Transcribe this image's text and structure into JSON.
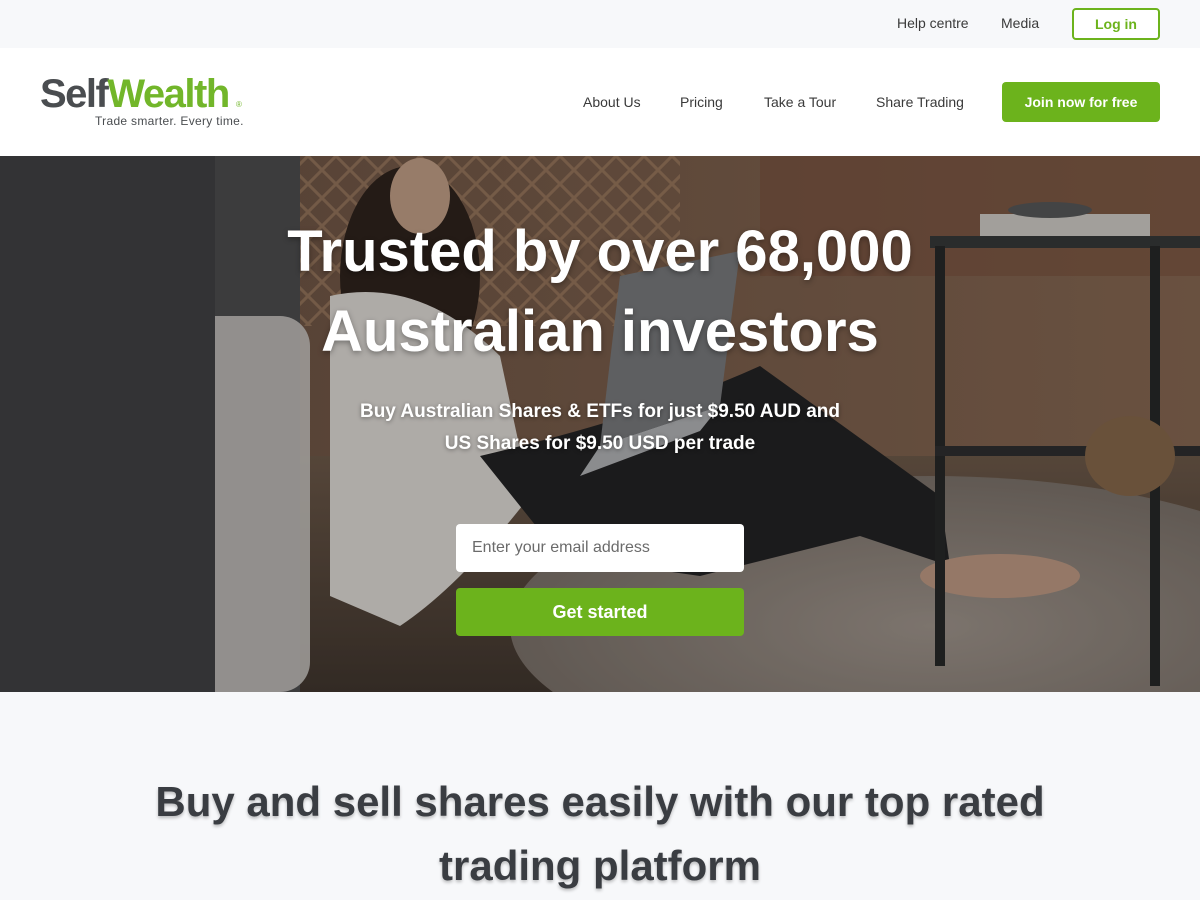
{
  "utility_nav": {
    "help_label": "Help centre",
    "media_label": "Media",
    "login_label": "Log in"
  },
  "brand": {
    "name_part1": "Self",
    "name_part2": "Wealth",
    "registered_mark": "®",
    "tagline": "Trade smarter. Every time.",
    "dark_color": "#4a4d50",
    "accent_color": "#72b62a"
  },
  "main_nav": {
    "items": [
      {
        "label": "About Us"
      },
      {
        "label": "Pricing"
      },
      {
        "label": "Take a Tour"
      },
      {
        "label": "Share Trading"
      }
    ],
    "cta_label": "Join now for free"
  },
  "hero": {
    "title": "Trusted by over 68,000 Australian investors",
    "subtitle_line1": "Buy Australian Shares & ETFs for just $9.50 AUD and",
    "subtitle_line2": "US Shares for $9.50 USD per trade",
    "email_placeholder": "Enter your email address",
    "button_label": "Get started"
  },
  "features": {
    "heading": "Buy and sell shares easily with our top rated trading platform"
  },
  "colors": {
    "primary_green": "#6cb31c",
    "page_background": "#f7f8fa",
    "heading_text": "#3a3d42"
  }
}
